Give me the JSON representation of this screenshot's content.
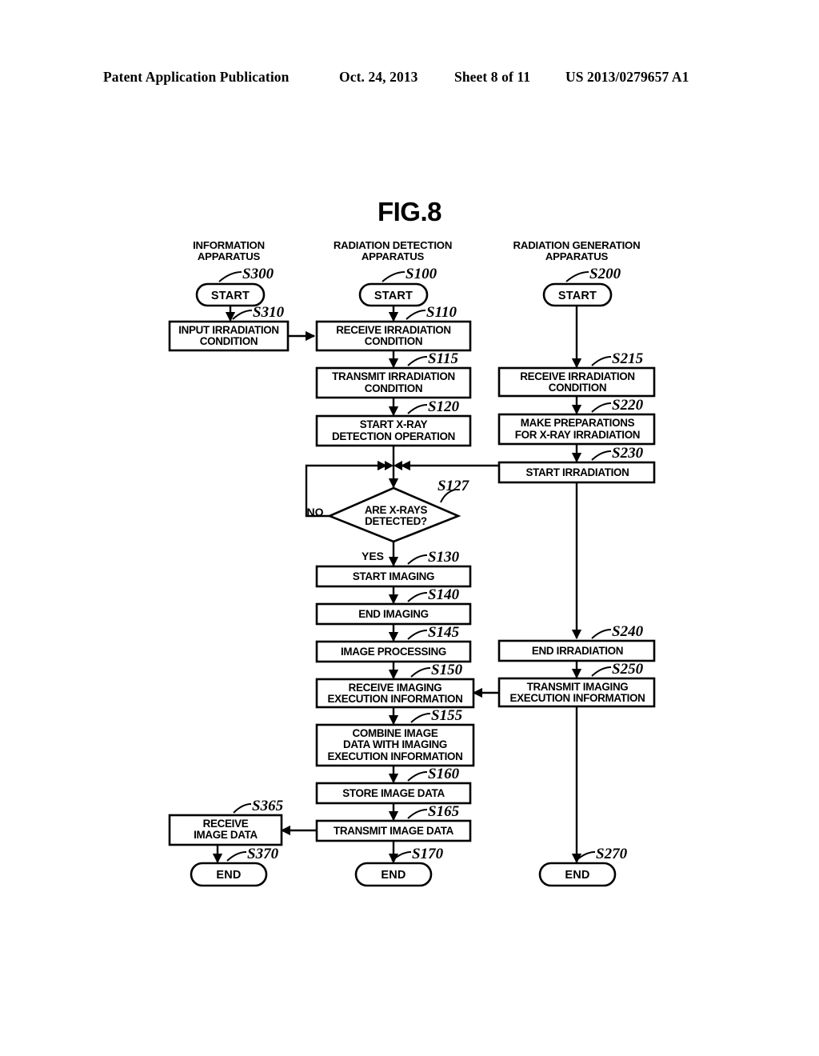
{
  "header": {
    "publication": "Patent Application Publication",
    "date": "Oct. 24, 2013",
    "sheet": "Sheet 8 of 11",
    "patent_number": "US 2013/0279657 A1"
  },
  "figure": {
    "title": "FIG.8",
    "type": "flowchart",
    "lanes": [
      {
        "id": "information",
        "title_line1": "INFORMATION",
        "title_line2": "APPARATUS"
      },
      {
        "id": "detection",
        "title_line1": "RADIATION DETECTION",
        "title_line2": "APPARATUS"
      },
      {
        "id": "generation",
        "title_line1": "RADIATION GENERATION",
        "title_line2": "APPARATUS"
      }
    ],
    "nodes": [
      {
        "id": "s300",
        "ref": "S300",
        "shape": "pill",
        "lane": "information",
        "lines": [
          "START"
        ]
      },
      {
        "id": "s310",
        "ref": "S310",
        "shape": "process",
        "lane": "information",
        "lines": [
          "INPUT IRRADIATION",
          "CONDITION"
        ]
      },
      {
        "id": "s365",
        "ref": "S365",
        "shape": "process",
        "lane": "information",
        "lines": [
          "RECEIVE",
          "IMAGE DATA"
        ]
      },
      {
        "id": "s370",
        "ref": "S370",
        "shape": "pill",
        "lane": "information",
        "lines": [
          "END"
        ]
      },
      {
        "id": "s100",
        "ref": "S100",
        "shape": "pill",
        "lane": "detection",
        "lines": [
          "START"
        ]
      },
      {
        "id": "s110",
        "ref": "S110",
        "shape": "process",
        "lane": "detection",
        "lines": [
          "RECEIVE IRRADIATION",
          "CONDITION"
        ]
      },
      {
        "id": "s115",
        "ref": "S115",
        "shape": "process",
        "lane": "detection",
        "lines": [
          "TRANSMIT IRRADIATION",
          "CONDITION"
        ]
      },
      {
        "id": "s120",
        "ref": "S120",
        "shape": "process",
        "lane": "detection",
        "lines": [
          "START X-RAY",
          "DETECTION OPERATION"
        ]
      },
      {
        "id": "s127",
        "ref": "S127",
        "shape": "decision",
        "lane": "detection",
        "lines": [
          "ARE X-RAYS",
          "DETECTED?"
        ],
        "branch_no": "NO",
        "branch_yes": "YES"
      },
      {
        "id": "s130",
        "ref": "S130",
        "shape": "process",
        "lane": "detection",
        "lines": [
          "START IMAGING"
        ]
      },
      {
        "id": "s140",
        "ref": "S140",
        "shape": "process",
        "lane": "detection",
        "lines": [
          "END IMAGING"
        ]
      },
      {
        "id": "s145",
        "ref": "S145",
        "shape": "process",
        "lane": "detection",
        "lines": [
          "IMAGE PROCESSING"
        ]
      },
      {
        "id": "s150",
        "ref": "S150",
        "shape": "process",
        "lane": "detection",
        "lines": [
          "RECEIVE IMAGING",
          "EXECUTION INFORMATION"
        ]
      },
      {
        "id": "s155",
        "ref": "S155",
        "shape": "process",
        "lane": "detection",
        "lines": [
          "COMBINE IMAGE",
          "DATA WITH IMAGING",
          "EXECUTION INFORMATION"
        ]
      },
      {
        "id": "s160",
        "ref": "S160",
        "shape": "process",
        "lane": "detection",
        "lines": [
          "STORE IMAGE DATA"
        ]
      },
      {
        "id": "s165",
        "ref": "S165",
        "shape": "process",
        "lane": "detection",
        "lines": [
          "TRANSMIT IMAGE DATA"
        ]
      },
      {
        "id": "s170",
        "ref": "S170",
        "shape": "pill",
        "lane": "detection",
        "lines": [
          "END"
        ]
      },
      {
        "id": "s200",
        "ref": "S200",
        "shape": "pill",
        "lane": "generation",
        "lines": [
          "START"
        ]
      },
      {
        "id": "s215",
        "ref": "S215",
        "shape": "process",
        "lane": "generation",
        "lines": [
          "RECEIVE IRRADIATION",
          "CONDITION"
        ]
      },
      {
        "id": "s220",
        "ref": "S220",
        "shape": "process",
        "lane": "generation",
        "lines": [
          "MAKE PREPARATIONS",
          "FOR X-RAY IRRADIATION"
        ]
      },
      {
        "id": "s230",
        "ref": "S230",
        "shape": "process",
        "lane": "generation",
        "lines": [
          "START IRRADIATION"
        ]
      },
      {
        "id": "s240",
        "ref": "S240",
        "shape": "process",
        "lane": "generation",
        "lines": [
          "END IRRADIATION"
        ]
      },
      {
        "id": "s250",
        "ref": "S250",
        "shape": "process",
        "lane": "generation",
        "lines": [
          "TRANSMIT IMAGING",
          "EXECUTION INFORMATION"
        ]
      },
      {
        "id": "s270",
        "ref": "S270",
        "shape": "pill",
        "lane": "generation",
        "lines": [
          "END"
        ]
      }
    ],
    "edges": [
      {
        "from": "s300",
        "to": "s310",
        "kind": "vertical"
      },
      {
        "from": "s310",
        "to": "s110",
        "kind": "cross-lane-right"
      },
      {
        "from": "s100",
        "to": "s110",
        "kind": "vertical"
      },
      {
        "from": "s110",
        "to": "s115",
        "kind": "vertical"
      },
      {
        "from": "s115",
        "to": "s215",
        "kind": "cross-lane-right"
      },
      {
        "from": "s115",
        "to": "s120",
        "kind": "vertical"
      },
      {
        "from": "s120",
        "to": "s127",
        "kind": "vertical"
      },
      {
        "from": "s200",
        "to": "s215",
        "kind": "vertical"
      },
      {
        "from": "s215",
        "to": "s220",
        "kind": "vertical"
      },
      {
        "from": "s220",
        "to": "s230",
        "kind": "vertical"
      },
      {
        "from": "s230",
        "to": "s127",
        "kind": "cross-lane-left"
      },
      {
        "from": "s127",
        "to": "s130",
        "kind": "vertical",
        "label": "YES"
      },
      {
        "from": "s127",
        "to": "s127",
        "kind": "loop-back",
        "label": "NO"
      },
      {
        "from": "s130",
        "to": "s140",
        "kind": "vertical"
      },
      {
        "from": "s140",
        "to": "s145",
        "kind": "vertical"
      },
      {
        "from": "s145",
        "to": "s150",
        "kind": "vertical"
      },
      {
        "from": "s230",
        "to": "s240",
        "kind": "vertical"
      },
      {
        "from": "s240",
        "to": "s250",
        "kind": "vertical"
      },
      {
        "from": "s250",
        "to": "s150",
        "kind": "cross-lane-left"
      },
      {
        "from": "s150",
        "to": "s155",
        "kind": "vertical"
      },
      {
        "from": "s155",
        "to": "s160",
        "kind": "vertical"
      },
      {
        "from": "s160",
        "to": "s165",
        "kind": "vertical"
      },
      {
        "from": "s165",
        "to": "s365",
        "kind": "cross-lane-left"
      },
      {
        "from": "s165",
        "to": "s170",
        "kind": "vertical"
      },
      {
        "from": "s365",
        "to": "s370",
        "kind": "vertical"
      },
      {
        "from": "s250",
        "to": "s270",
        "kind": "vertical"
      }
    ]
  }
}
